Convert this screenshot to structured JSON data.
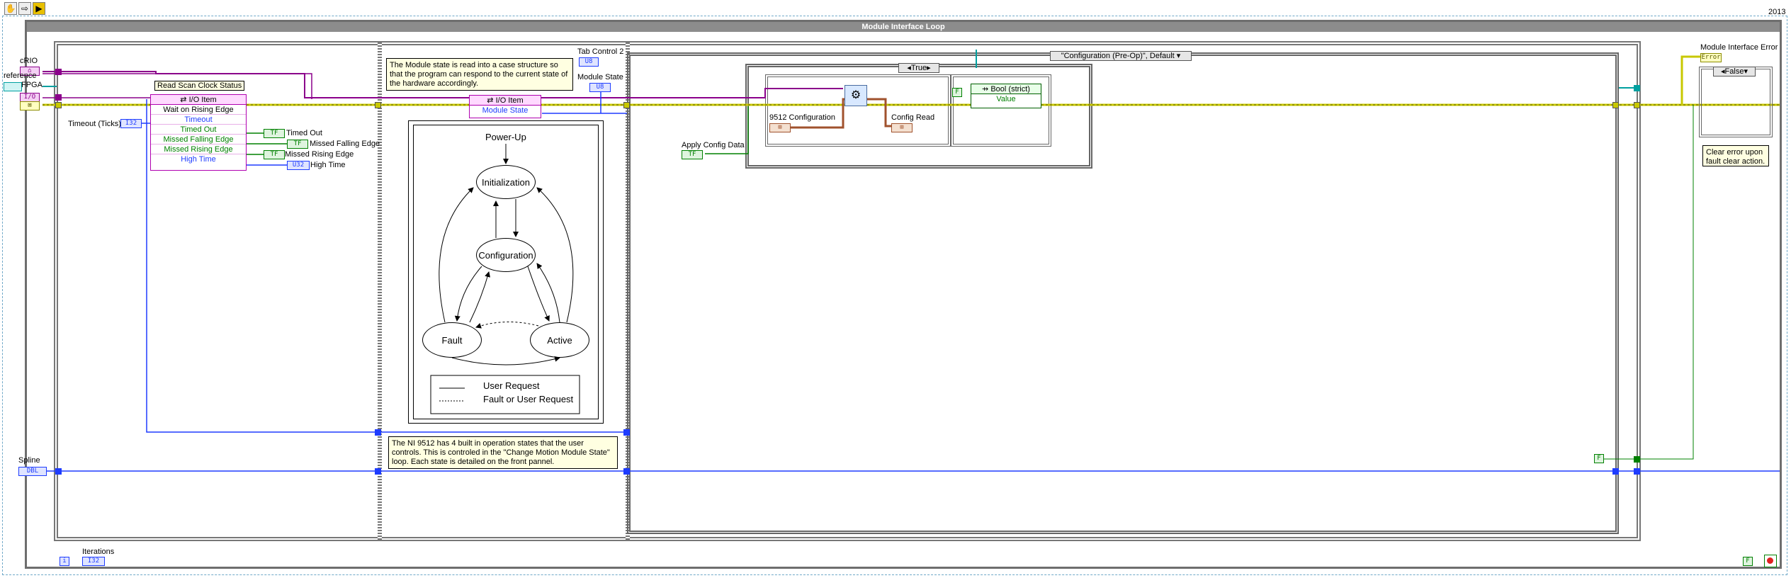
{
  "toolbar": {
    "buttons": [
      {
        "name": "highlight-execution-icon",
        "glyph": "✋"
      },
      {
        "name": "retain-wire-values-icon",
        "glyph": "⇨"
      },
      {
        "name": "step-into-icon",
        "glyph": "▶"
      }
    ],
    "version": "2013"
  },
  "loop": {
    "title": "Module Interface Loop",
    "iterations_label": "Iterations",
    "iteration_terminal": "i",
    "iteration_type": "I32"
  },
  "inputs": {
    "crio_label": "cRIO",
    "crio_type": "⌂",
    "reference_label": "reference",
    "fpga_label": "FPGA",
    "spline_label": "Spline",
    "spline_type": "DBL"
  },
  "frame0": {
    "read_status_label": "Read Scan Clock Status",
    "io_item_header": "I/O Item",
    "rows": [
      "Wait on Rising Edge",
      "Timeout",
      "Timed Out",
      "Missed Falling Edge",
      "Missed Rising Edge",
      "High Time"
    ],
    "timeout_label": "Timeout (Ticks)",
    "timeout_type": "I32",
    "outputs": [
      {
        "label": "Timed Out",
        "type": "TF"
      },
      {
        "label": "Missed Falling Edge",
        "type": "TF"
      },
      {
        "label": "Missed Rising Edge",
        "type": "TF"
      },
      {
        "label": "High Time",
        "type": "U32"
      }
    ]
  },
  "frame1": {
    "note_top": "The Module state is read into a case structure so that the program can respond to the current state of the hardware accordingly.",
    "note_bottom": "The NI 9512 has 4 built in operation states that the user controls.  This is controled in the \"Change Motion Module State\" loop.  Each state is detailed on the front pannel.",
    "tab_control_label": "Tab Control 2",
    "tab_control_type": "U8",
    "module_state_label": "Module State",
    "module_state_type": "U8",
    "io_item_header": "I/O Item",
    "io_item_row": "Module State",
    "diagram": {
      "power_up": "Power-Up",
      "states": [
        "Initialization",
        "Configuration",
        "Fault",
        "Active"
      ],
      "legend": [
        "User Request",
        "Fault or User Request"
      ]
    }
  },
  "frame2": {
    "case_selector": "\"Configuration (Pre-Op)\", Default",
    "inner_case_selector": "True",
    "apply_config_label": "Apply Config Data",
    "apply_config_type": "TF",
    "config_label": "9512 Configuration",
    "config_read_label": "Config Read",
    "bool_node_label": "Bool (strict)",
    "bool_node_row": "Value",
    "false_const": "F"
  },
  "right": {
    "error_label": "Module Interface Error",
    "error_type": "Error",
    "false_case_selector": "False",
    "note": "Clear error upon fault clear action."
  },
  "colors": {
    "loop_border": "#6e6e6e",
    "wire_class": "#8b008b",
    "wire_error": "#c8c800",
    "wire_int": "#1e3cff",
    "wire_bool": "#008000",
    "wire_cluster": "#a0522d",
    "io_node_bg": "#ffd9ff",
    "note_bg": "#ffffe1"
  }
}
